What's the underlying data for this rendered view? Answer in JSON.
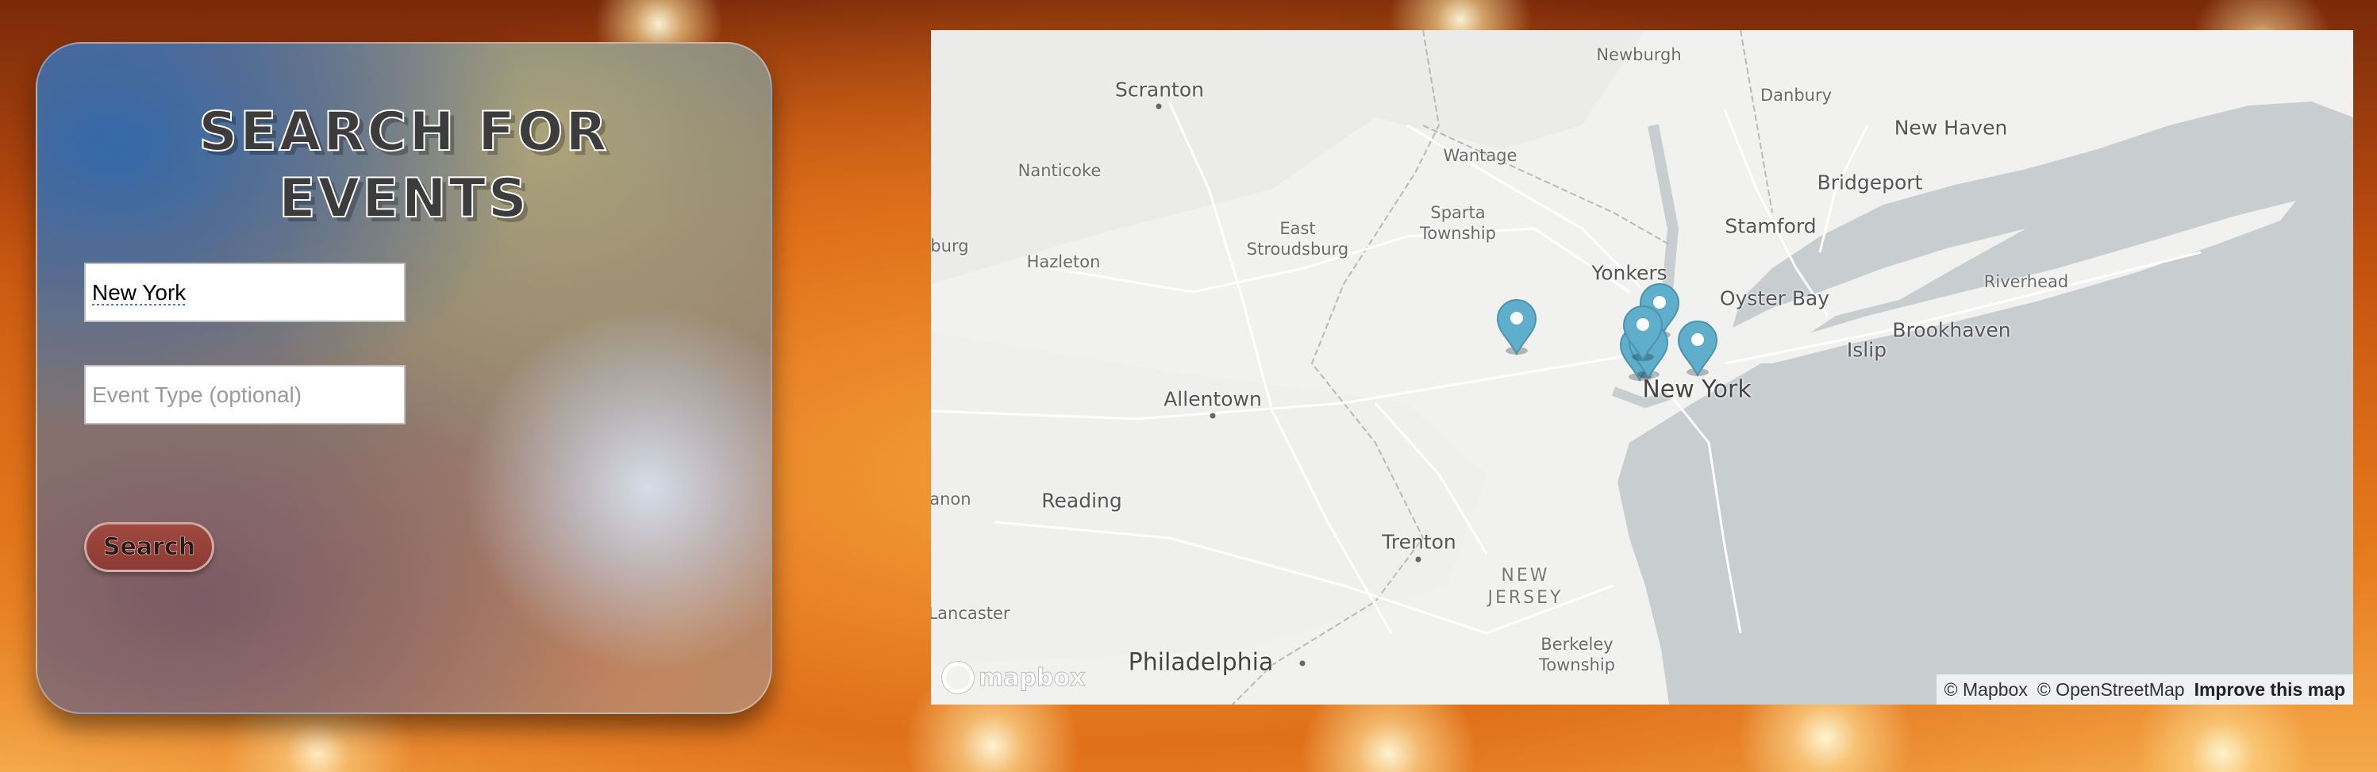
{
  "panel": {
    "title": "SEARCH FOR EVENTS",
    "city_value": "New York",
    "event_type_placeholder": "Event Type (optional)",
    "search_label": "Search"
  },
  "map": {
    "labels": {
      "newburgh": "Newburgh",
      "scranton": "Scranton",
      "danbury": "Danbury",
      "new_haven": "New Haven",
      "wantage": "Wantage",
      "nanticoke": "Nanticoke",
      "bridgeport": "Bridgeport",
      "sparta": "Sparta\nTownship",
      "east_stroudsburg": "East\nStroudsburg",
      "stamford": "Stamford",
      "bloomsburg": "sburg",
      "hazleton": "Hazleton",
      "yonkers": "Yonkers",
      "riverhead": "Riverhead",
      "oyster_bay": "Oyster Bay",
      "brookhaven": "Brookhaven",
      "islip": "Islip",
      "allentown": "Allentown",
      "new_york": "New York",
      "lebanon": "oanon",
      "reading": "Reading",
      "trenton": "Trenton",
      "new_jersey": "NEW\nJERSEY",
      "lancaster": "Lancaster",
      "berkeley": "Berkeley\nTownship",
      "philadelphia": "Philadelphia"
    },
    "logo_text": "mapbox",
    "attribution": {
      "mapbox": "© Mapbox",
      "osm": "© OpenStreetMap",
      "improve": "Improve this map"
    },
    "marker_color": "#5fafcc",
    "water_color": "#c8cdd0"
  }
}
